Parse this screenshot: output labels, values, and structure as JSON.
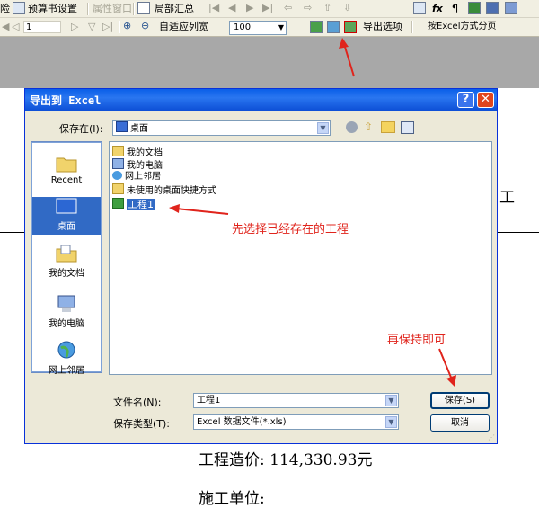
{
  "toolbar1": {
    "item1": "险",
    "item2": "预算书设置",
    "item3": "属性窗口",
    "item4": "局部汇总"
  },
  "toolbar2": {
    "page_value": "1",
    "fit_width": "自适应列宽",
    "zoom_value": "100",
    "export_options": "导出选项",
    "excel_paging": "按Excel方式分页"
  },
  "dialog": {
    "title": "导出到 Excel",
    "save_in_label": "保存在(I):",
    "save_in_value": "桌面",
    "places": [
      "Recent",
      "桌面",
      "我的文档",
      "我的电脑",
      "网上邻居"
    ],
    "files": [
      "我的文档",
      "我的电脑",
      "网上邻居",
      "未使用的桌面快捷方式",
      "工程1"
    ],
    "filename_label": "文件名(N):",
    "filename_value": "工程1",
    "filetype_label": "保存类型(T):",
    "filetype_value": "Excel 数据文件(*.xls)",
    "save_button": "保存(S)",
    "cancel_button": "取消"
  },
  "annotations": {
    "select_project": "先选择已经存在的工程",
    "then_save": "再保持即可"
  },
  "document": {
    "cost_line": "工程造价: 114,330.93元",
    "unit_line": "施工单位:",
    "right_char": "工"
  },
  "colors": {
    "annotation_red": "#e0241c",
    "title_blue": "#0a5fe8",
    "selection_blue": "#316ac5"
  }
}
